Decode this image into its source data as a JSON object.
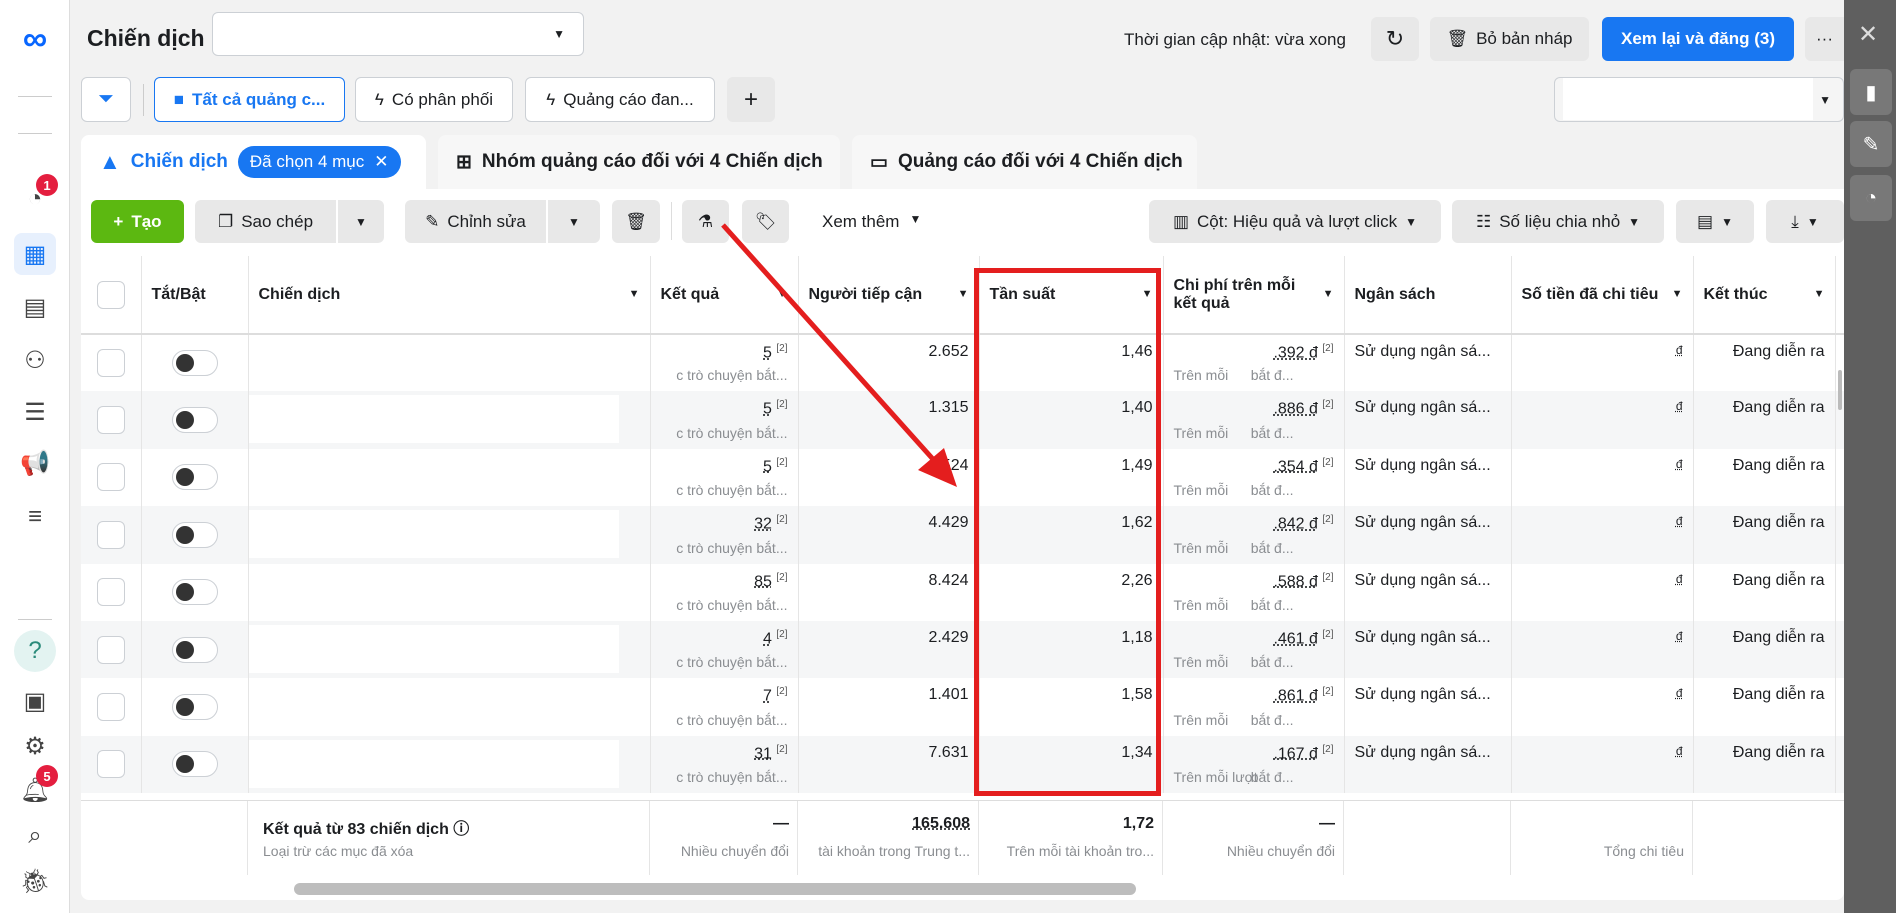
{
  "header": {
    "title": "Chiến dịch",
    "update_time": "Thời gian cập nhật: vừa xong",
    "discard_label": "Bỏ bản nháp",
    "publish_label": "Xem lại và đăng (3)",
    "more_label": "···"
  },
  "filters": {
    "items": [
      "Tất cả quảng c...",
      "Có phân phối",
      "Quảng cáo đan..."
    ],
    "add_label": "+"
  },
  "tabs": {
    "campaigns": "Chiến dịch",
    "selected_chip": "Đã chọn 4 mục",
    "adsets": "Nhóm quảng cáo đối với 4 Chiến dịch",
    "ads": "Quảng cáo đối với 4 Chiến dịch"
  },
  "toolbar": {
    "create": "Tạo",
    "duplicate": "Sao chép",
    "edit": "Chỉnh sửa",
    "see_more": "Xem thêm",
    "columns": "Cột: Hiệu quả và lượt click",
    "breakdown": "Số liệu chia nhỏ"
  },
  "sidebar": {
    "notif_badge": "1",
    "bell_badge": "5"
  },
  "table": {
    "headers": [
      "Tắt/Bật",
      "Chiến dịch",
      "Kết quả",
      "Người tiếp cận",
      "Tần suất",
      "Chi phí trên mỗi kết quả",
      "Ngân sách",
      "Số tiền đã chi tiêu",
      "Kết thúc"
    ],
    "rows": [
      {
        "result": "5",
        "result_sub": "c trò chuyện bắt...",
        "reach": "2.652",
        "freq": "1,46",
        "cost": ".392 đ",
        "cost_sub_left": "Trên mỗi",
        "cost_sub": "bắt đ...",
        "budget": "Sử dụng ngân sá...",
        "spent": "đ",
        "end": "Đang diễn ra"
      },
      {
        "result": "5",
        "result_sub": "c trò chuyện bắt...",
        "reach": "1.315",
        "freq": "1,40",
        "cost": ".886 đ",
        "cost_sub_left": "Trên mỗi",
        "cost_sub": "bắt đ...",
        "budget": "Sử dụng ngân sá...",
        "spent": "đ",
        "end": "Đang diễn ra"
      },
      {
        "result": "5",
        "result_sub": "c trò chuyện bắt...",
        "reach": "524",
        "freq": "1,49",
        "cost": ".354 đ",
        "cost_sub_left": "Trên mỗi",
        "cost_sub": "bắt đ...",
        "budget": "Sử dụng ngân sá...",
        "spent": "đ",
        "end": "Đang diễn ra"
      },
      {
        "result": "32",
        "result_sub": "c trò chuyện bắt...",
        "reach": "4.429",
        "freq": "1,62",
        "cost": ".842 đ",
        "cost_sub_left": "Trên mỗi",
        "cost_sub": "bắt đ...",
        "budget": "Sử dụng ngân sá...",
        "spent": "đ",
        "end": "Đang diễn ra"
      },
      {
        "result": "85",
        "result_sub": "c trò chuyện bắt...",
        "reach": "8.424",
        "freq": "2,26",
        "cost": ".588 đ",
        "cost_sub_left": "Trên mỗi",
        "cost_sub": "bắt đ...",
        "budget": "Sử dụng ngân sá...",
        "spent": "đ",
        "end": "Đang diễn ra"
      },
      {
        "result": "4",
        "result_sub": "c trò chuyện bắt...",
        "reach": "2.429",
        "freq": "1,18",
        "cost": ".461 đ",
        "cost_sub_left": "Trên mỗi",
        "cost_sub": "bắt đ...",
        "budget": "Sử dụng ngân sá...",
        "spent": "đ",
        "end": "Đang diễn ra"
      },
      {
        "result": "7",
        "result_sub": "c trò chuyện bắt...",
        "reach": "1.401",
        "freq": "1,58",
        "cost": ".861 đ",
        "cost_sub_left": "Trên mỗi",
        "cost_sub": "bắt đ...",
        "budget": "Sử dụng ngân sá...",
        "spent": "đ",
        "end": "Đang diễn ra"
      },
      {
        "result": "31",
        "result_sub": "c trò chuyện bắt...",
        "reach": "7.631",
        "freq": "1,34",
        "cost": ".167 đ",
        "cost_sub_left": "Trên mỗi lượt",
        "cost_sub": "bắt đ...",
        "budget": "Sử dụng ngân sá...",
        "spent": "đ",
        "end": "Đang diễn ra"
      }
    ],
    "footnote": "[2]"
  },
  "footer": {
    "title": "Kết quả từ 83 chiến dịch",
    "subtitle": "Loại trừ các mục đã xóa",
    "result": "—",
    "result_sub": "Nhiều chuyển đổi",
    "reach": "165.608",
    "reach_sub": "tài khoản trong Trung t...",
    "freq": "1,72",
    "freq_sub": "Trên mỗi tài khoản tro...",
    "cost": "—",
    "cost_sub": "Nhiều chuyển đổi",
    "spent_sub": "Tổng chi tiêu"
  },
  "colors": {
    "accent": "#1877f2",
    "create": "#5cb811",
    "annotation": "#e41e1e"
  }
}
